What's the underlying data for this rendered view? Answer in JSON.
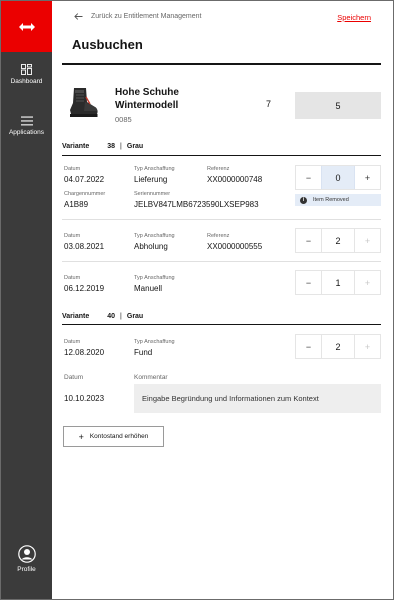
{
  "sidebar": {
    "dashboard_label": "Dashboard",
    "applications_label": "Applications",
    "profile_label": "Profile"
  },
  "header": {
    "back_label": "Zurück zu Entitlement Management",
    "save_label": "Speichern",
    "title": "Ausbuchen"
  },
  "product": {
    "name": "Hohe Schuhe Wintermodell",
    "code": "0085",
    "count": "7",
    "quantity": "5"
  },
  "labels": {
    "datum": "Datum",
    "typ_anschaffung": "Typ Anschaffung",
    "referenz": "Referenz",
    "chargennummer": "Chargennummer",
    "seriennummer": "Seriennummer",
    "kommentar": "Kommentar",
    "variante": "Variante",
    "sep": "|",
    "minus": "−",
    "plus": "+"
  },
  "variants": [
    {
      "size": "38",
      "color": "Grau"
    },
    {
      "size": "40",
      "color": "Grau"
    }
  ],
  "entries": [
    {
      "datum": "04.07.2022",
      "typ": "Lieferung",
      "referenz": "XX0000000748",
      "charge": "A1B89",
      "serie": "JELBV847LMB6723590LXSEP983",
      "qty": "0",
      "badge": "Item Removed"
    },
    {
      "datum": "03.08.2021",
      "typ": "Abholung",
      "referenz": "XX0000000555",
      "qty": "2"
    },
    {
      "datum": "06.12.2019",
      "typ": "Manuell",
      "qty": "1"
    },
    {
      "datum": "12.08.2020",
      "typ": "Fund",
      "qty": "2"
    }
  ],
  "comment_row": {
    "datum": "10.10.2023",
    "placeholder": "Eingabe Begründung und Informationen zum Kontext"
  },
  "add_button_label": "Kontostand erhöhen",
  "colors": {
    "brand": "#eb0000",
    "sidebar": "#3b3b3b",
    "highlight": "#e4ecf7"
  }
}
